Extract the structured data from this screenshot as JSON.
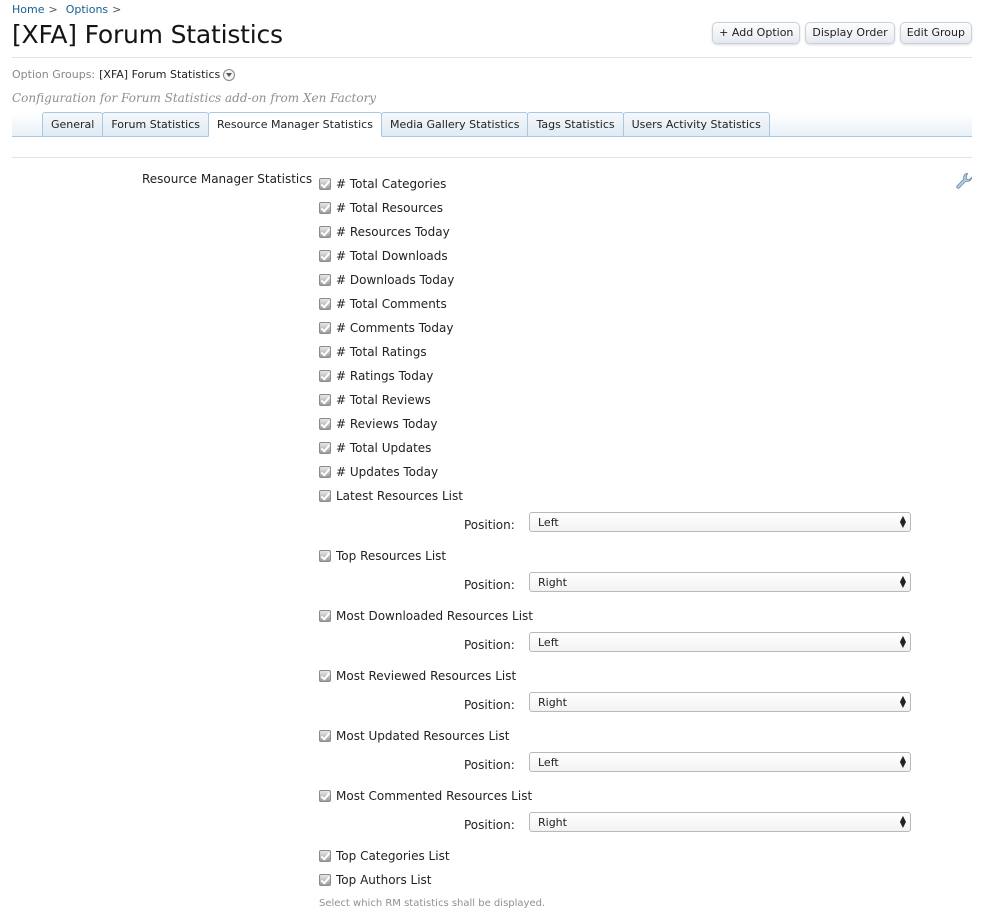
{
  "breadcrumb": {
    "items": [
      "Home",
      "Options"
    ],
    "sep": ">"
  },
  "title": "[XFA] Forum Statistics",
  "buttons": {
    "add": "+ Add Option",
    "order": "Display Order",
    "edit": "Edit Group"
  },
  "option_groups": {
    "label": "Option Groups:",
    "value": "[XFA] Forum Statistics"
  },
  "description": "Configuration for Forum Statistics add-on from Xen Factory",
  "tabs": [
    "General",
    "Forum Statistics",
    "Resource Manager Statistics",
    "Media Gallery Statistics",
    "Tags Statistics",
    "Users Activity Statistics"
  ],
  "active_tab": "Resource Manager Statistics",
  "section_label": "Resource Manager Statistics",
  "position_label": "Position:",
  "options": [
    {
      "label": "# Total Categories",
      "checked": true
    },
    {
      "label": "# Total Resources",
      "checked": true
    },
    {
      "label": "# Resources Today",
      "checked": true
    },
    {
      "label": "# Total Downloads",
      "checked": true
    },
    {
      "label": "# Downloads Today",
      "checked": true
    },
    {
      "label": "# Total Comments",
      "checked": true
    },
    {
      "label": "# Comments Today",
      "checked": true
    },
    {
      "label": "# Total Ratings",
      "checked": true
    },
    {
      "label": "# Ratings Today",
      "checked": true
    },
    {
      "label": "# Total Reviews",
      "checked": true
    },
    {
      "label": "# Reviews Today",
      "checked": true
    },
    {
      "label": "# Total Updates",
      "checked": true
    },
    {
      "label": "# Updates Today",
      "checked": true
    },
    {
      "label": "Latest Resources List",
      "checked": true,
      "position": "Left"
    },
    {
      "label": "Top Resources List",
      "checked": true,
      "position": "Right"
    },
    {
      "label": "Most Downloaded Resources List",
      "checked": true,
      "position": "Left"
    },
    {
      "label": "Most Reviewed Resources List",
      "checked": true,
      "position": "Right"
    },
    {
      "label": "Most Updated Resources List",
      "checked": true,
      "position": "Left"
    },
    {
      "label": "Most Commented Resources List",
      "checked": true,
      "position": "Right"
    },
    {
      "label": "Top Categories List",
      "checked": true
    },
    {
      "label": "Top Authors List",
      "checked": true
    }
  ],
  "hint": "Select which RM statistics shall be displayed."
}
